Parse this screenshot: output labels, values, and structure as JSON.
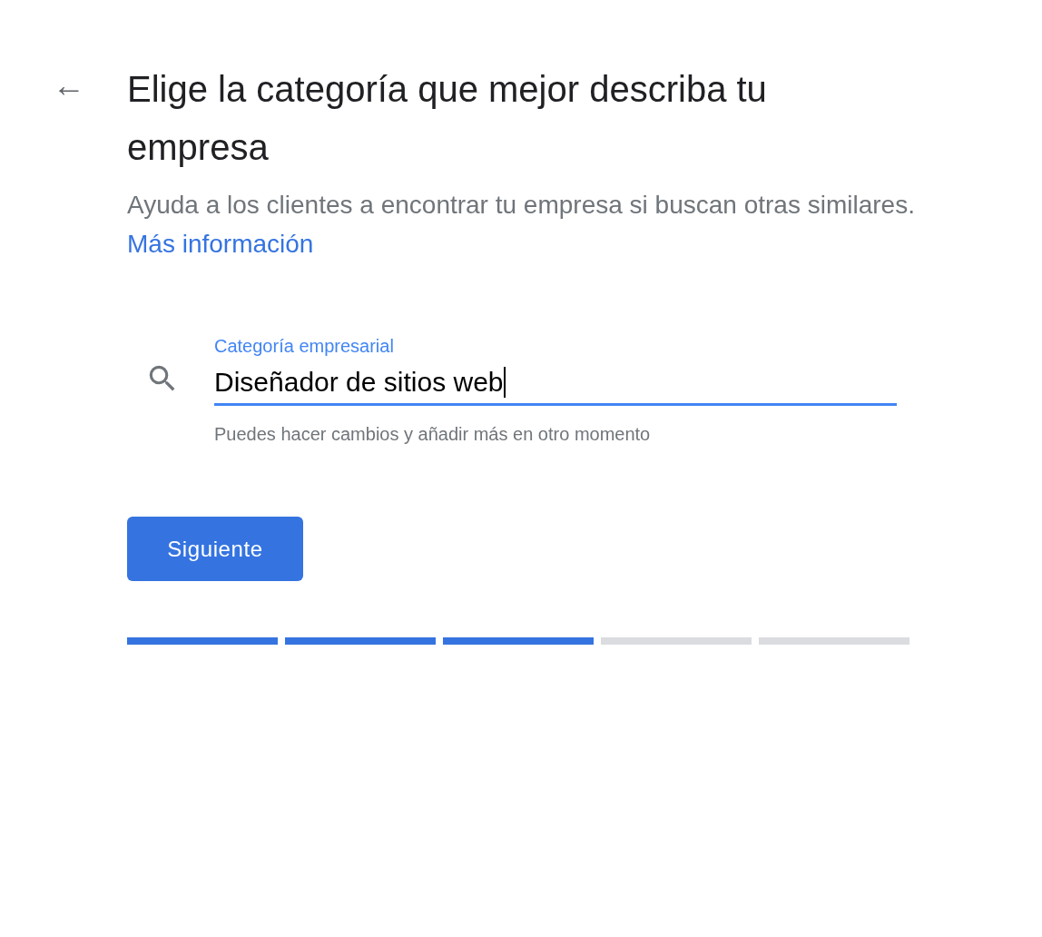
{
  "back_button": {
    "label": "←"
  },
  "title": "Elige la categoría que mejor describa tu empresa",
  "subtitle": {
    "text": "Ayuda a los clientes a encontrar tu empresa si buscan otras similares.",
    "link": "Más información"
  },
  "field": {
    "label": "Categoría empresarial",
    "value": "Diseñador de sitios web",
    "focused": true,
    "helper": "Puedes hacer cambios y añadir más en otro momento"
  },
  "button": "Siguiente",
  "progress": [
    {
      "done": true
    },
    {
      "done": true
    },
    {
      "done": true
    },
    {
      "done": false
    },
    {
      "done": false
    }
  ]
}
